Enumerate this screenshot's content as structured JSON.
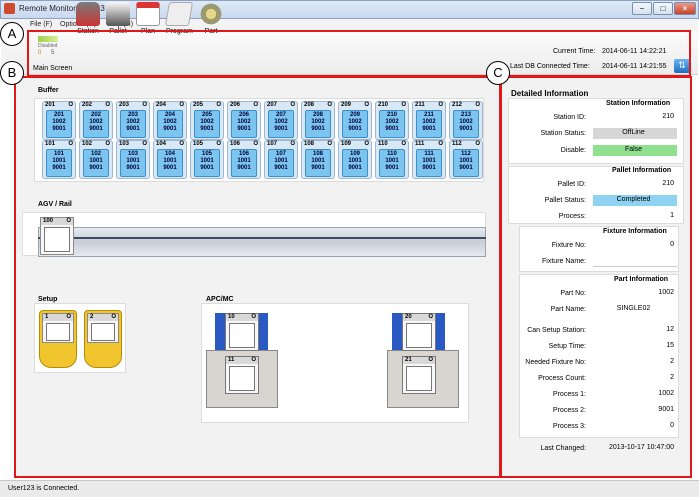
{
  "window": {
    "title": "Remote Monitor_1AC13",
    "minimize": "−",
    "maximize": "□",
    "close": "×"
  },
  "menu": [
    "File (F)",
    "Options (O)",
    "Help (H)"
  ],
  "toolbar": {
    "mini_status": "Disabled",
    "mini_values": [
      "0",
      "5"
    ],
    "items": [
      {
        "label": "Main Screen",
        "icon": "monitor-icon"
      },
      {
        "label": "Station",
        "icon": "robot-icon"
      },
      {
        "label": "Pallet",
        "icon": "pallet-icon"
      },
      {
        "label": "Plan",
        "icon": "calendar-icon"
      },
      {
        "label": "Program",
        "icon": "document-icon"
      },
      {
        "label": "Part",
        "icon": "gear-icon"
      }
    ],
    "current_time_label": "Current Time:",
    "current_time": "2014-06-11 14:22:21",
    "last_db_label": "Last DB Connected Time:",
    "last_db": "2014-06-11 14:21:55"
  },
  "callouts": [
    "A",
    "B",
    "C"
  ],
  "buffer": {
    "title": "Buffer",
    "row1": [
      {
        "id": "201",
        "a": "201",
        "b": "1002",
        "c": "9001"
      },
      {
        "id": "202",
        "a": "202",
        "b": "1002",
        "c": "9001"
      },
      {
        "id": "203",
        "a": "203",
        "b": "1002",
        "c": "9001"
      },
      {
        "id": "204",
        "a": "204",
        "b": "1002",
        "c": "9001"
      },
      {
        "id": "205",
        "a": "205",
        "b": "1002",
        "c": "9001"
      },
      {
        "id": "206",
        "a": "206",
        "b": "1002",
        "c": "9001"
      },
      {
        "id": "207",
        "a": "207",
        "b": "1002",
        "c": "9001"
      },
      {
        "id": "208",
        "a": "208",
        "b": "1002",
        "c": "9001"
      },
      {
        "id": "209",
        "a": "209",
        "b": "1002",
        "c": "9001"
      },
      {
        "id": "210",
        "a": "210",
        "b": "1002",
        "c": "9001"
      },
      {
        "id": "211",
        "a": "211",
        "b": "1002",
        "c": "9001"
      },
      {
        "id": "212",
        "a": "213",
        "b": "1002",
        "c": "9001"
      }
    ],
    "row2": [
      {
        "id": "101",
        "a": "101",
        "b": "1001",
        "c": "9001"
      },
      {
        "id": "102",
        "a": "102",
        "b": "1001",
        "c": "9001"
      },
      {
        "id": "103",
        "a": "103",
        "b": "1001",
        "c": "9001"
      },
      {
        "id": "104",
        "a": "104",
        "b": "1001",
        "c": "9001"
      },
      {
        "id": "105",
        "a": "105",
        "b": "1001",
        "c": "9001"
      },
      {
        "id": "106",
        "a": "106",
        "b": "1001",
        "c": "9001"
      },
      {
        "id": "107",
        "a": "107",
        "b": "1001",
        "c": "9001"
      },
      {
        "id": "108",
        "a": "108",
        "b": "1001",
        "c": "9001"
      },
      {
        "id": "109",
        "a": "109",
        "b": "1001",
        "c": "9001"
      },
      {
        "id": "110",
        "a": "110",
        "b": "1001",
        "c": "9001"
      },
      {
        "id": "111",
        "a": "111",
        "b": "1001",
        "c": "9001"
      },
      {
        "id": "112",
        "a": "112",
        "b": "1001",
        "c": "9001"
      }
    ],
    "flag": "O"
  },
  "agv": {
    "title": "AGV / Rail",
    "carrier": "100",
    "flag": "O"
  },
  "setup": {
    "title": "Setup",
    "slots": [
      "1",
      "2"
    ],
    "flag": "O"
  },
  "apc": {
    "title": "APC/MC",
    "m1_top": "10",
    "m1_bottom": "11",
    "m2_top": "20",
    "m2_bottom": "21",
    "flag": "O"
  },
  "details": {
    "title": "Detailed Information",
    "station": {
      "title": "Station Information",
      "id_label": "Station ID:",
      "id": "210",
      "status_label": "Station Status:",
      "status": "OffLine",
      "disable_label": "Disable:",
      "disable": "False"
    },
    "pallet": {
      "title": "Pallet Information",
      "id_label": "Pallet ID:",
      "id": "210",
      "status_label": "Pallet Status:",
      "status": "Completed",
      "process_label": "Process:",
      "process": "1"
    },
    "fixture": {
      "title": "Fixture Information",
      "no_label": "Fixture No:",
      "no": "0",
      "name_label": "Fixture Name:",
      "name": ""
    },
    "part": {
      "title": "Part Information",
      "no_label": "Part No:",
      "no": "1002",
      "name_label": "Part Name:",
      "name": "SINGLE02",
      "can_label": "Can Setup Station:",
      "can": "12",
      "setup_label": "Setup Time:",
      "setup": "15",
      "needed_label": "Needed Fixture No:",
      "needed": "2",
      "count_label": "Process Count:",
      "count": "2",
      "p1_label": "Process 1:",
      "p1": "1002",
      "p2_label": "Process 2:",
      "p2": "9001",
      "p3_label": "Process 3:",
      "p3": "0"
    },
    "changed_label": "Last Changed:",
    "changed": "2013-10-17 10:47:00"
  },
  "status": {
    "text": "User123 is Connected."
  },
  "colors": {
    "offline": "#d6d6d6",
    "false": "#8fe08f",
    "completed": "#8fd3f2",
    "highlight": "#e01818"
  }
}
